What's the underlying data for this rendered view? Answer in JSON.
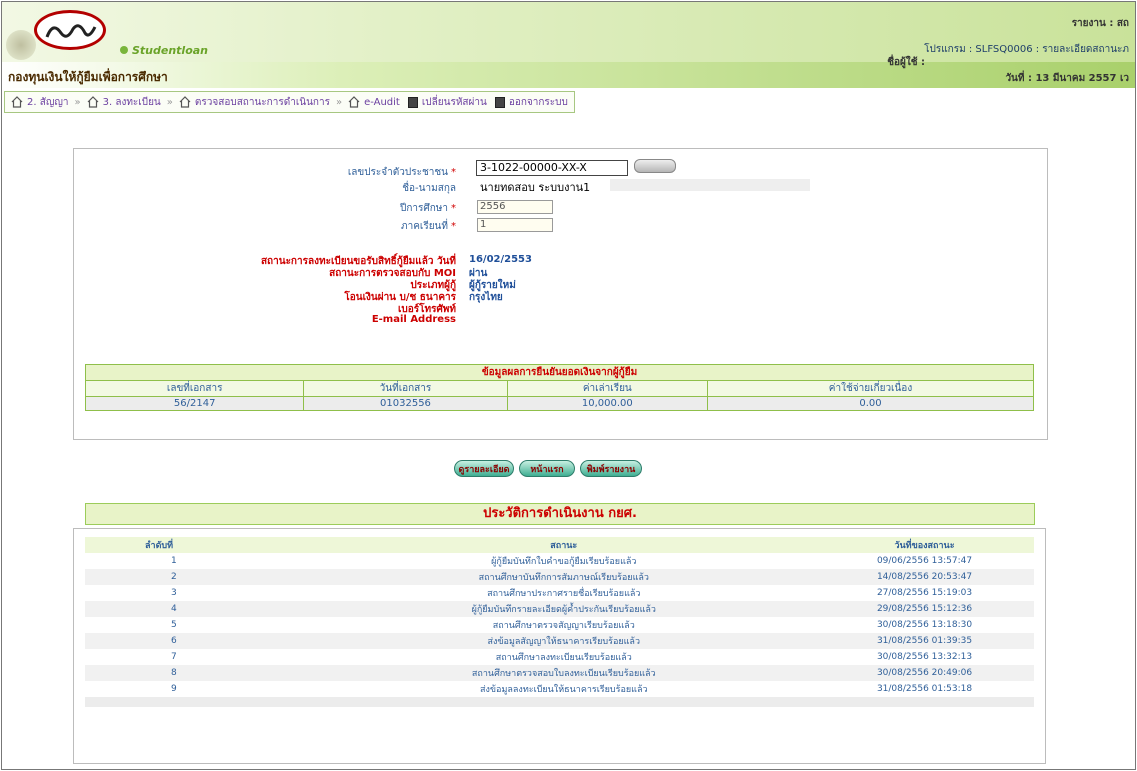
{
  "header": {
    "brand": "Studentloan",
    "org": "กองทุนเงินให้กู้ยืมเพื่อการศึกษา",
    "user_label": "รายงาน : สถ",
    "program_label": "โปรแกรม : SLFSQ0006 : รายละเอียดสถานะภ",
    "user_name_label": "ชื่อผู้ใช้ :",
    "date_label": "วันที่ : 13 มีนาคม 2557 เว"
  },
  "menu": [
    {
      "icon": "home-icon",
      "label": "2. สัญญา"
    },
    {
      "icon": "home-icon",
      "label": "3. ลงทะเบียน"
    },
    {
      "icon": "home-icon",
      "label": "ตรวจสอบสถานะการดำเนินการ"
    },
    {
      "icon": "home-icon",
      "label": "e-Audit"
    },
    {
      "icon": "document-icon",
      "label": "เปลี่ยนรหัสผ่าน"
    },
    {
      "icon": "document-icon",
      "label": "ออกจากระบบ"
    }
  ],
  "form": {
    "id_label": "เลขประจำตัวประชาชน",
    "id_value": "3-1022-00000-XX-X",
    "name_label": "ชื่อ-นามสกุล",
    "name_value": "นายทดสอบ  ระบบงาน1",
    "year_label": "ปีการศึกษา",
    "year_value": "2556",
    "term_label": "ภาคเรียนที่",
    "term_value": "1",
    "required_mark": "*"
  },
  "status": [
    {
      "label": "สถานะการลงทะเบียนขอรับสิทธิ์กู้ยืมแล้ว วันที่",
      "value": "16/02/2553"
    },
    {
      "label": "สถานะการตรวจสอบกับ MOI",
      "value": "ผ่าน"
    },
    {
      "label": "ประเภทผู้กู้",
      "value": "ผู้กู้รายใหม่"
    },
    {
      "label": "โอนเงินผ่าน บ/ช ธนาคาร",
      "value": "กรุงไทย"
    },
    {
      "label": "เบอร์โทรศัพท์",
      "value": ""
    },
    {
      "label": "E-mail Address",
      "value": ""
    }
  ],
  "loan_table": {
    "caption": "ข้อมูลผลการยืนยันยอดเงินจากผู้กู้ยืม",
    "headers": [
      "เลขที่เอกสาร",
      "วันที่เอกสาร",
      "ค่าเล่าเรียน",
      "ค่าใช้จ่ายเกี่ยวเนื่อง"
    ],
    "rows": [
      [
        "56/2147",
        "01032556",
        "10,000.00",
        "0.00"
      ]
    ]
  },
  "buttons": [
    "ดูรายละเอียด",
    "หน้าแรก",
    "พิมพ์รายงาน"
  ],
  "history": {
    "title": "ประวัติการดำเนินงาน กยศ.",
    "headers": [
      "ลำดับที่",
      "สถานะ",
      "วันที่ของสถานะ"
    ],
    "rows": [
      [
        "1",
        "ผู้กู้ยืมบันทึกใบคำขอกู้ยืมเรียบร้อยแล้ว",
        "09/06/2556 13:57:47"
      ],
      [
        "2",
        "สถานศึกษาบันทึกการสัมภาษณ์เรียบร้อยแล้ว",
        "14/08/2556 20:53:47"
      ],
      [
        "3",
        "สถานศึกษาประกาศรายชื่อเรียบร้อยแล้ว",
        "27/08/2556 15:19:03"
      ],
      [
        "4",
        "ผู้กู้ยืมบันทึกรายละเอียดผู้ค้ำประกันเรียบร้อยแล้ว",
        "29/08/2556 15:12:36"
      ],
      [
        "5",
        "สถานศึกษาตรวจสัญญาเรียบร้อยแล้ว",
        "30/08/2556 13:18:30"
      ],
      [
        "6",
        "ส่งข้อมูลสัญญาให้ธนาคารเรียบร้อยแล้ว",
        "31/08/2556 01:39:35"
      ],
      [
        "7",
        "สถานศึกษาลงทะเบียนเรียบร้อยแล้ว",
        "30/08/2556 13:32:13"
      ],
      [
        "8",
        "สถานศึกษาตรวจสอบใบลงทะเบียนเรียบร้อยแล้ว",
        "30/08/2556 20:49:06"
      ],
      [
        "9",
        "ส่งข้อมูลลงทะเบียนให้ธนาคารเรียบร้อยแล้ว",
        "31/08/2556 01:53:18"
      ]
    ]
  },
  "colors": {
    "accent": "#a9d06b",
    "title_red": "#cc0000",
    "link": "#2f5f99"
  }
}
